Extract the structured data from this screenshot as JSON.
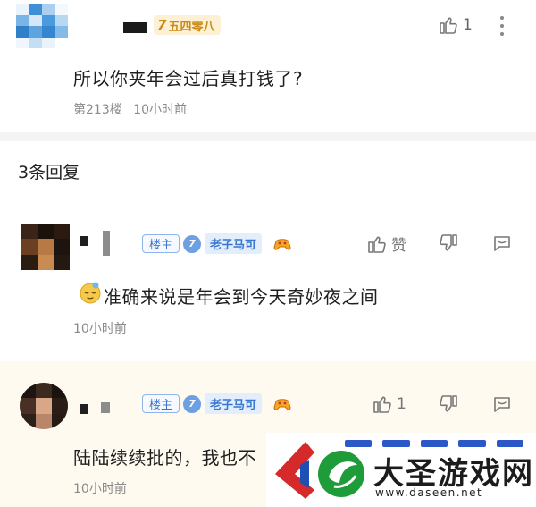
{
  "top_comment": {
    "level_badge": {
      "number": "7",
      "text": "五四零八"
    },
    "like_count": "1",
    "text": "所以你夹年会过后真打钱了?",
    "floor": "第213楼",
    "time": "10小时前",
    "icons": {
      "like": "thumb-up-icon",
      "more": "more-vertical-icon"
    }
  },
  "replies_header": {
    "label": "3条回复"
  },
  "replies": [
    {
      "host_tag": "楼主",
      "fan_level": "7",
      "fan_name": "老子马可",
      "like_label": "赞",
      "text": "准确来说是年会到今天奇妙夜之间",
      "time": "10小时前"
    },
    {
      "host_tag": "楼主",
      "fan_level": "7",
      "fan_name": "老子马可",
      "like_label": "1",
      "text": "陆陆续续批的，我也不",
      "time": "10小时前"
    }
  ],
  "watermark": {
    "title": "大圣游戏网",
    "url": "www.daseen.net"
  },
  "colors": {
    "accent_blue": "#3a76cf",
    "badge_gold": "#c98a16",
    "reply_highlight_bg": "#fffaf0"
  }
}
